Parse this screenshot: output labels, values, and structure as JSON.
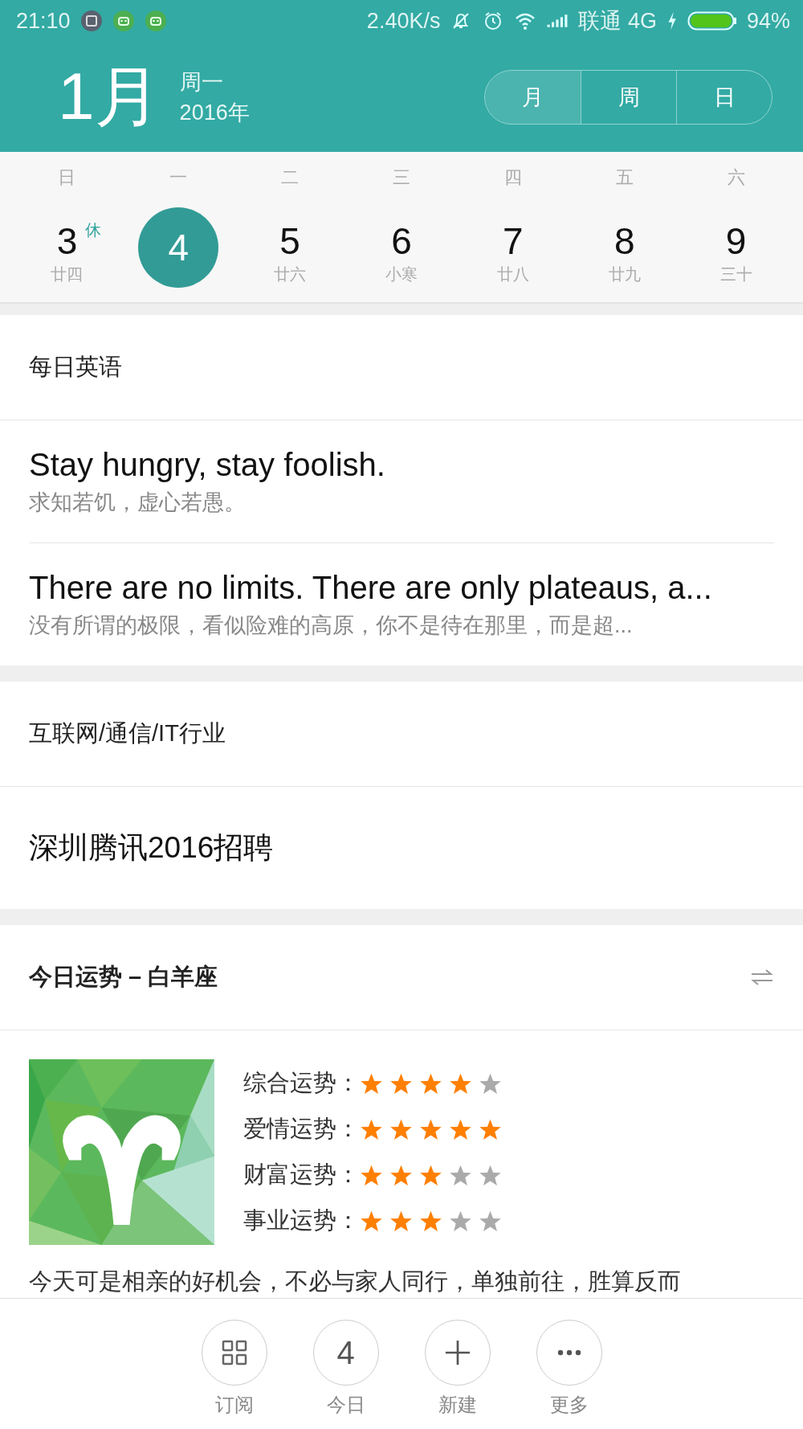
{
  "status_bar": {
    "time": "21:10",
    "speed": "2.40K/s",
    "carrier": "联通 4G",
    "battery": "94%"
  },
  "header": {
    "month": "1月",
    "weekday": "周一",
    "year": "2016年",
    "views": [
      {
        "label": "月",
        "selected": true
      },
      {
        "label": "周",
        "selected": false
      },
      {
        "label": "日",
        "selected": false
      }
    ]
  },
  "week": {
    "weekdays": [
      "日",
      "一",
      "二",
      "三",
      "四",
      "五",
      "六"
    ],
    "days": [
      {
        "date": "3",
        "lunar": "廿四",
        "badge": "休",
        "selected": false
      },
      {
        "date": "4",
        "selected": true
      },
      {
        "date": "5",
        "lunar": "廿六",
        "selected": false
      },
      {
        "date": "6",
        "lunar": "小寒",
        "selected": false
      },
      {
        "date": "7",
        "lunar": "廿八",
        "selected": false
      },
      {
        "date": "8",
        "lunar": "廿九",
        "selected": false
      },
      {
        "date": "9",
        "lunar": "三十",
        "selected": false
      }
    ]
  },
  "english": {
    "title": "每日英语",
    "items": [
      {
        "en": "Stay hungry, stay foolish.",
        "zh": "求知若饥，虚心若愚。"
      },
      {
        "en": "There are no limits. There are only plateaus, a...",
        "zh": "没有所谓的极限，看似险难的高原，你不是待在那里，而是超..."
      }
    ]
  },
  "jobs": {
    "title": "互联网/通信/IT行业",
    "items": [
      "深圳腾讯2016招聘"
    ]
  },
  "horoscope": {
    "title": "今日运势 – 白羊座",
    "ratings": [
      {
        "label": "综合运势：",
        "stars": 4
      },
      {
        "label": "爱情运势：",
        "stars": 5
      },
      {
        "label": "财富运势：",
        "stars": 3
      },
      {
        "label": "事业运势：",
        "stars": 3
      }
    ],
    "text": "今天可是相亲的好机会，不必与家人同行，单独前往，胜算反而"
  },
  "toolbar": [
    {
      "kind": "grid",
      "label": "订阅"
    },
    {
      "kind": "today",
      "number": "4",
      "label": "今日"
    },
    {
      "kind": "add",
      "label": "新建"
    },
    {
      "kind": "more",
      "label": "更多"
    }
  ]
}
